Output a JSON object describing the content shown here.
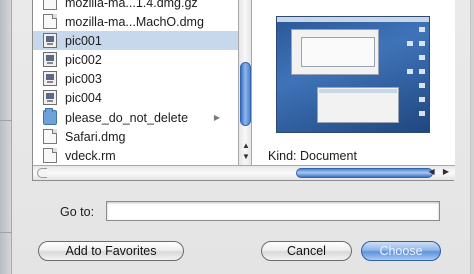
{
  "browser": {
    "files": [
      {
        "label": "mozilla-ma...1.4.dmg.gz",
        "icon": "document-icon",
        "selected": false
      },
      {
        "label": "mozilla-ma...MachO.dmg",
        "icon": "document-icon",
        "selected": false
      },
      {
        "label": "pic001",
        "icon": "picture-icon",
        "selected": true
      },
      {
        "label": "pic002",
        "icon": "picture-icon",
        "selected": false
      },
      {
        "label": "pic003",
        "icon": "picture-icon",
        "selected": false
      },
      {
        "label": "pic004",
        "icon": "picture-icon",
        "selected": false
      },
      {
        "label": "please_do_not_delete",
        "icon": "folder-icon",
        "selected": false,
        "has_children": true
      },
      {
        "label": "Safari.dmg",
        "icon": "document-icon",
        "selected": false
      },
      {
        "label": "vdeck.rm",
        "icon": "document-icon",
        "selected": false
      }
    ],
    "expand_arrow": "▶",
    "scroll_up": "▲",
    "scroll_down": "▼"
  },
  "preview": {
    "kind_label": "Kind: Document"
  },
  "hscroll": {
    "arrows": "◀ ▶"
  },
  "goto": {
    "label": "Go to:",
    "value": "",
    "placeholder": ""
  },
  "buttons": {
    "add_favorites": "Add to Favorites",
    "cancel": "Cancel",
    "choose": "Choose"
  },
  "colors": {
    "selection": "#c8d8ec",
    "aqua_blue": "#5f93db"
  }
}
